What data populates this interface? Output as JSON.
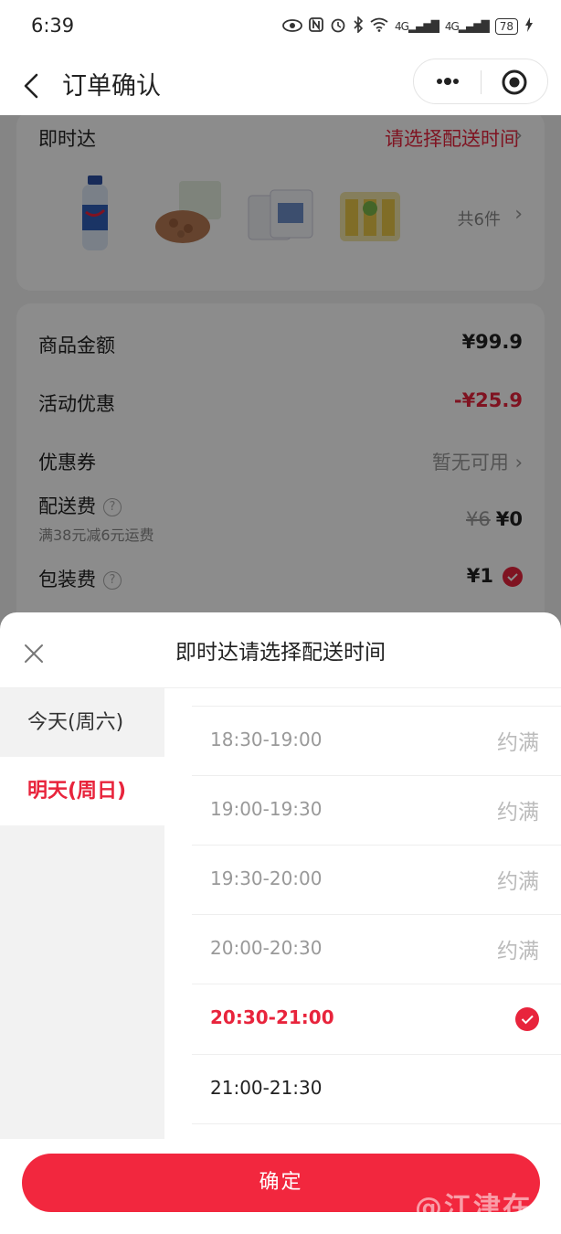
{
  "status_bar": {
    "time": "6:39",
    "net_1": "4G",
    "net_2": "4G",
    "battery": "78"
  },
  "nav": {
    "title": "订单确认"
  },
  "delivery": {
    "label": "即时达",
    "action": "请选择配送时间",
    "count_text": "共6件",
    "products": [
      "water-bottle",
      "nuts",
      "instant-food",
      "juice-pack"
    ]
  },
  "fees": {
    "goods_label": "商品金额",
    "goods_value": "¥99.9",
    "promo_label": "活动优惠",
    "promo_value": "-¥25.9",
    "coupon_label": "优惠券",
    "coupon_value": "暂无可用",
    "shipping_label": "配送费",
    "shipping_sub": "满38元减6元运费",
    "shipping_original": "¥6",
    "shipping_value": "¥0",
    "package_label": "包装费",
    "package_value": "¥1"
  },
  "sheet": {
    "title": "即时达请选择配送时间",
    "days": [
      {
        "label": "今天(周六)",
        "active": false
      },
      {
        "label": "明天(周日)",
        "active": true
      }
    ],
    "slots": [
      {
        "time": "18:30-19:00",
        "status": "约满",
        "state": "full"
      },
      {
        "time": "19:00-19:30",
        "status": "约满",
        "state": "full"
      },
      {
        "time": "19:30-20:00",
        "status": "约满",
        "state": "full"
      },
      {
        "time": "20:00-20:30",
        "status": "约满",
        "state": "full"
      },
      {
        "time": "20:30-21:00",
        "status": "",
        "state": "selected"
      },
      {
        "time": "21:00-21:30",
        "status": "",
        "state": "available"
      }
    ],
    "confirm_label": "确定"
  },
  "watermark": "@江津在线",
  "colors": {
    "accent": "#e8243c",
    "button": "#f2273e"
  }
}
